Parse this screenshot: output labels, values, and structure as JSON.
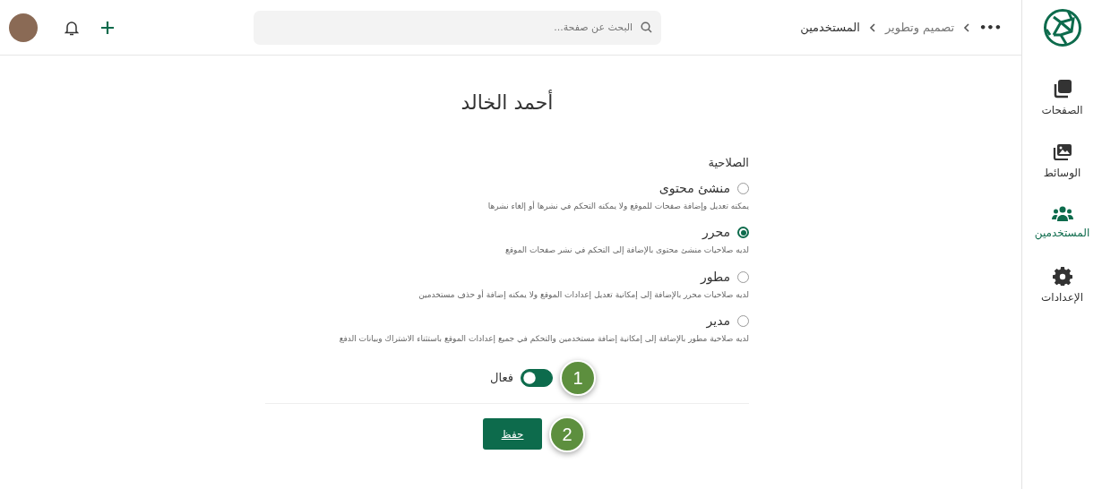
{
  "sidebar": {
    "items": [
      {
        "label": "الصفحات",
        "kind": "pages",
        "selected": false
      },
      {
        "label": "الوسائط",
        "kind": "media",
        "selected": false
      },
      {
        "label": "المستخدمين",
        "kind": "users",
        "selected": true
      },
      {
        "label": "الإعدادات",
        "kind": "settings",
        "selected": false
      }
    ]
  },
  "topbar": {
    "breadcrumb": [
      "•••",
      "تصميم وتطوير",
      "المستخدمين"
    ],
    "search": {
      "placeholder": "البحث عن صفحة..."
    }
  },
  "title": "أحمد الخالد",
  "permission": {
    "label": "الصلاحية",
    "options": [
      {
        "label": "منشئ محتوى",
        "description": "يمكنه تعديل وإضافة صفحات للموقع ولا يمكنه التحكم في نشرها أو إلغاء نشرها",
        "selected": false
      },
      {
        "label": "محرر",
        "description": "لديه صلاحيات منشئ محتوى بالإضافة إلى التحكم في نشر صفحات الموقع",
        "selected": true
      },
      {
        "label": "مطور",
        "description": "لديه صلاحيات محرر بالإضافة إلى إمكانية تعديل إعدادات الموقع ولا يمكنه إضافة أو حذف مستخدمين",
        "selected": false
      },
      {
        "label": "مدير",
        "description": "لديه صلاحية مطور بالإضافة إلى إمكانية إضافة مستخدمين والتحكم في جميع إعدادات الموقع باستثناء الاشتراك وبيانات الدفع",
        "selected": false
      }
    ]
  },
  "active": {
    "label": "فعال",
    "on": true,
    "callout": "1"
  },
  "save": {
    "label": "حفظ",
    "callout": "2"
  }
}
